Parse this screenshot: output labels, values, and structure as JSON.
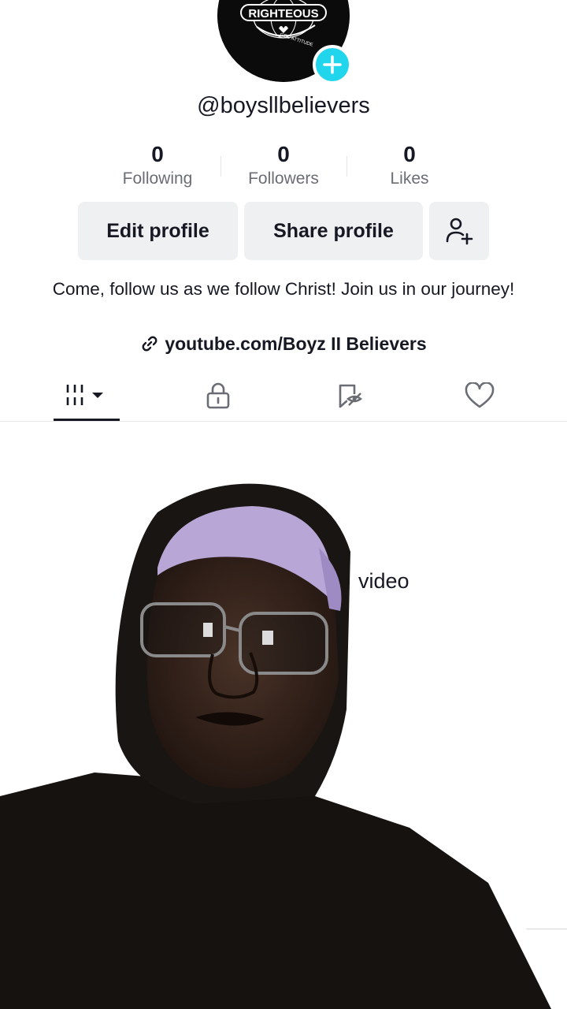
{
  "profile": {
    "username": "@boysllbelievers",
    "avatar_text": "RIGHTEOUS",
    "avatar_subtext": "GOD ATTITUDE",
    "bio": "Come, follow us as we follow Christ! Join us in our journey!",
    "link": "youtube.com/Boyz II Believers"
  },
  "stats": [
    {
      "value": "0",
      "label": "Following"
    },
    {
      "value": "0",
      "label": "Followers"
    },
    {
      "value": "0",
      "label": "Likes"
    }
  ],
  "buttons": {
    "edit": "Edit profile",
    "share": "Share profile"
  },
  "tabs": [
    {
      "name": "videos",
      "icon": "grid-icon",
      "active": true
    },
    {
      "name": "private",
      "icon": "lock-icon",
      "active": false
    },
    {
      "name": "reposts",
      "icon": "repost-icon",
      "active": false
    },
    {
      "name": "liked",
      "icon": "heart-icon",
      "active": false
    }
  ],
  "empty_state": {
    "text": "video"
  },
  "colors": {
    "accent": "#20d5ec",
    "text": "#161823",
    "muted": "#6b6d74",
    "button_bg": "#eff0f1"
  }
}
